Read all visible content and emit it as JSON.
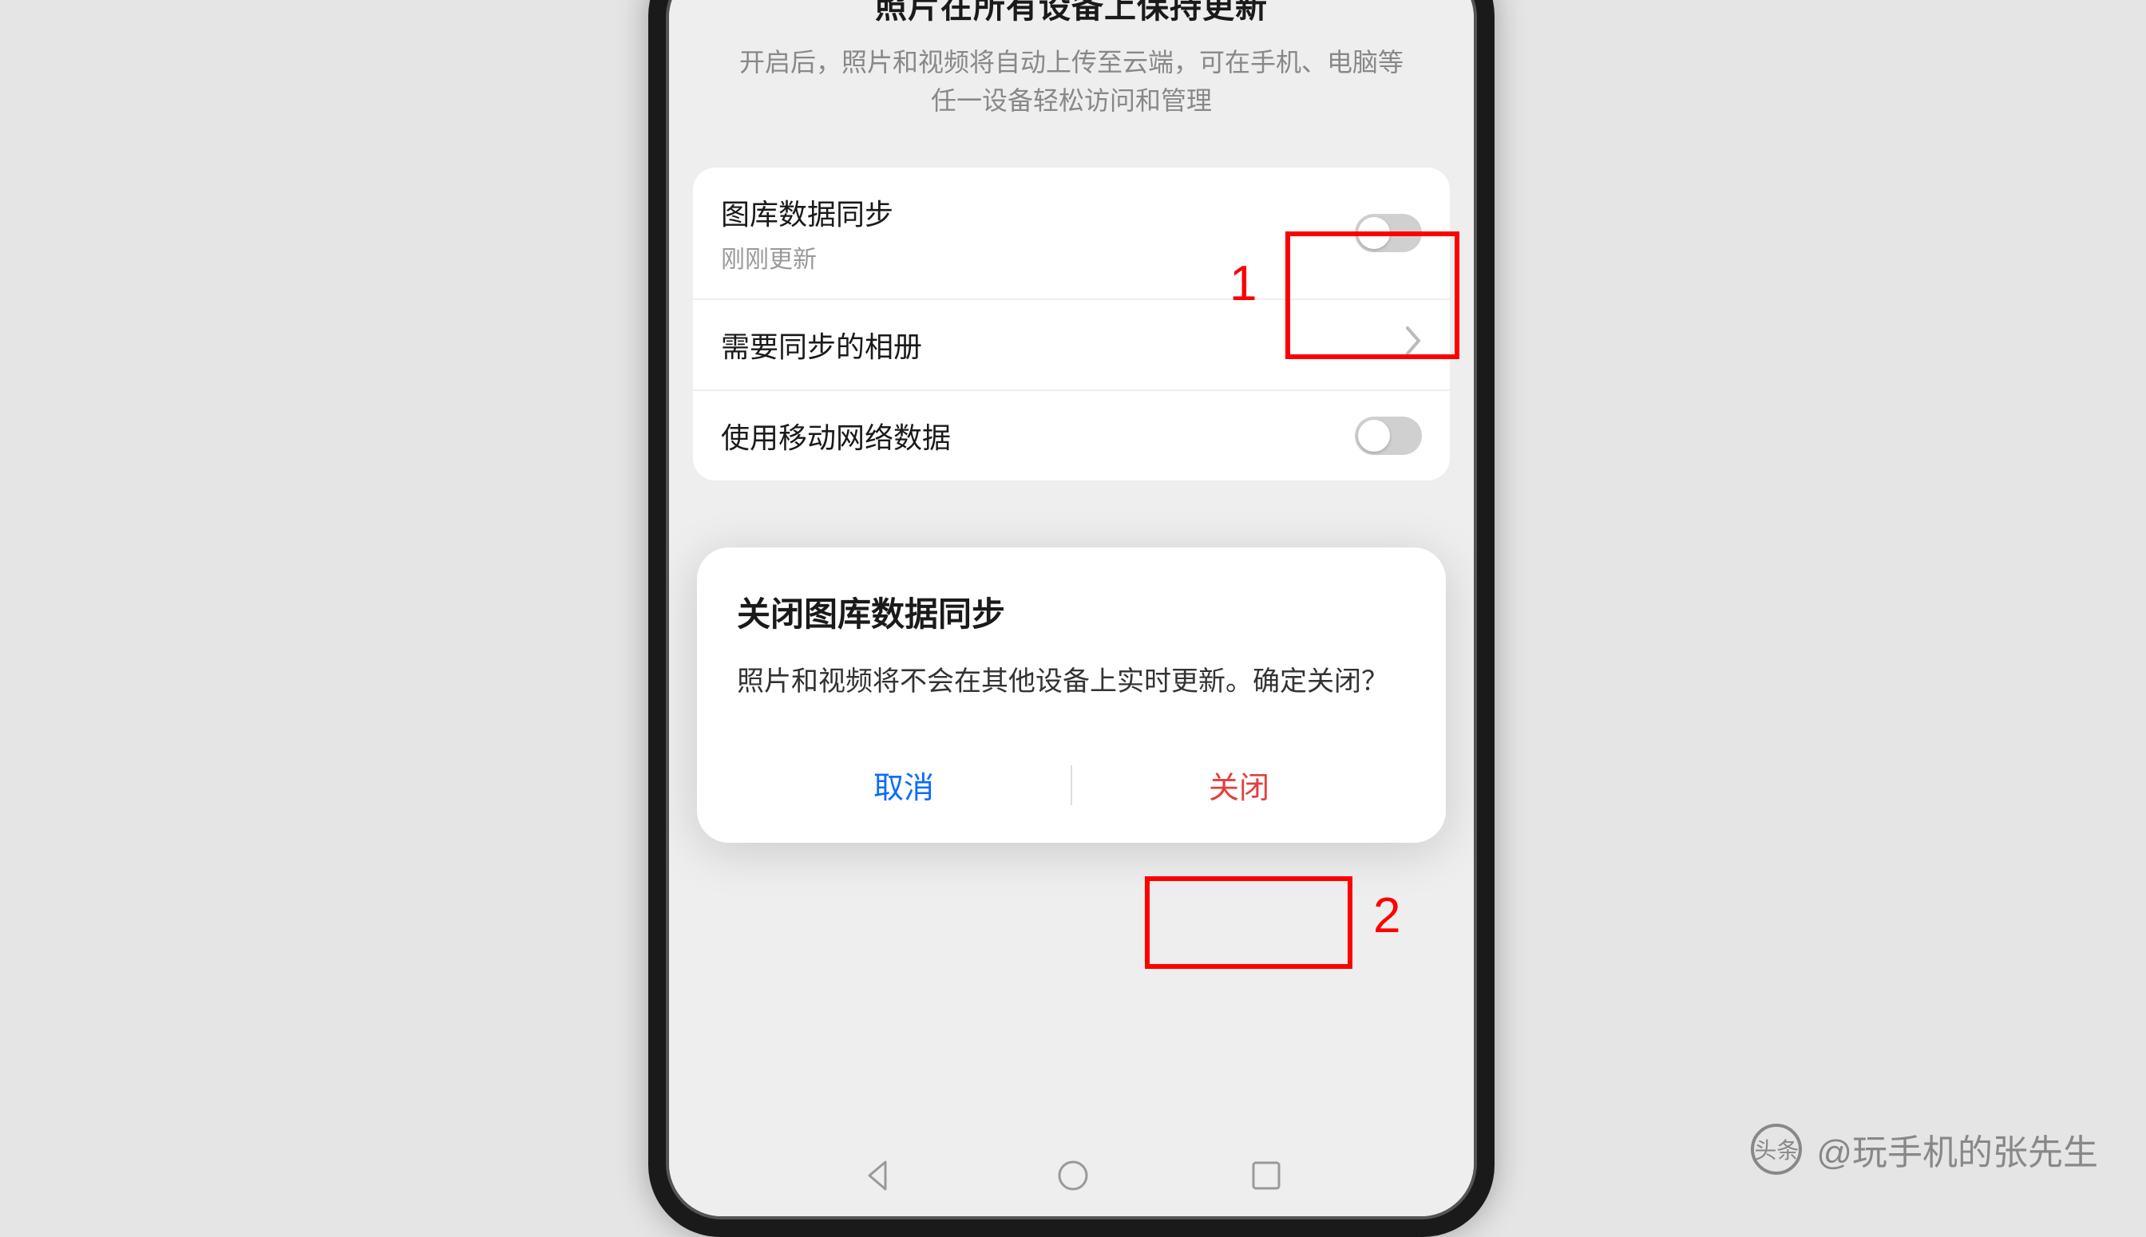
{
  "header": {
    "title": "照片在所有设备上保持更新",
    "description": "开启后，照片和视频将自动上传至云端，可在手机、电脑等任一设备轻松访问和管理"
  },
  "settings": {
    "sync": {
      "title": "图库数据同步",
      "subtitle": "刚刚更新",
      "enabled": false
    },
    "albums": {
      "title": "需要同步的相册"
    },
    "mobile_data": {
      "title": "使用移动网络数据",
      "enabled": false
    }
  },
  "dialog": {
    "title": "关闭图库数据同步",
    "body": "照片和视频将不会在其他设备上实时更新。确定关闭？",
    "cancel": "取消",
    "confirm": "关闭"
  },
  "annotations": {
    "label1": "1",
    "label2": "2"
  },
  "watermark": {
    "logo": "头条",
    "text": "@玩手机的张先生"
  }
}
